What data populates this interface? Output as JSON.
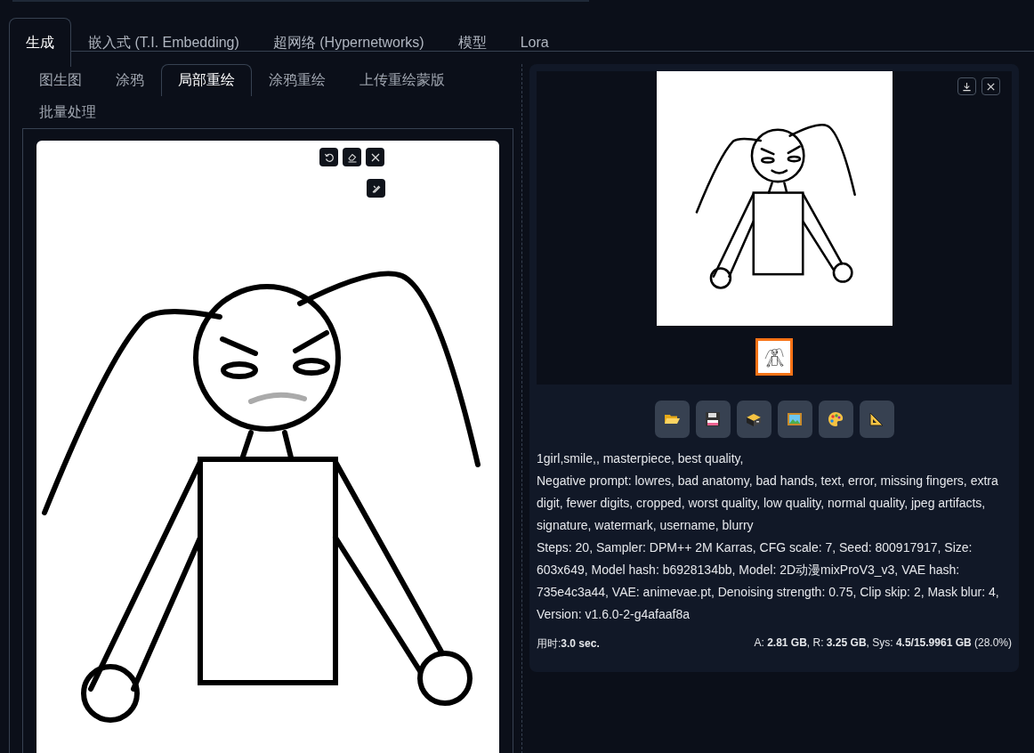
{
  "main_tabs": [
    {
      "label": "生成",
      "selected": true
    },
    {
      "label": "嵌入式 (T.I. Embedding)",
      "selected": false
    },
    {
      "label": "超网络 (Hypernetworks)",
      "selected": false
    },
    {
      "label": "模型",
      "selected": false
    },
    {
      "label": "Lora",
      "selected": false
    }
  ],
  "sub_tabs": [
    {
      "label": "图生图",
      "selected": false
    },
    {
      "label": "涂鸦",
      "selected": false
    },
    {
      "label": "局部重绘",
      "selected": true
    },
    {
      "label": "涂鸦重绘",
      "selected": false
    },
    {
      "label": "上传重绘蒙版",
      "selected": false
    },
    {
      "label": "批量处理",
      "selected": false
    }
  ],
  "output": {
    "thumbnails": [
      {
        "selected": true
      }
    ],
    "info": [
      "1girl,smile,, masterpiece, best quality,",
      "Negative prompt: lowres, bad anatomy, bad hands, text, error, missing fingers, extra digit, fewer digits, cropped, worst quality, low quality, normal quality, jpeg artifacts, signature, watermark, username, blurry",
      "Steps: 20, Sampler: DPM++ 2M Karras, CFG scale: 7, Seed: 800917917, Size: 603x649, Model hash: b6928134bb, Model: 2D动漫mixProV3_v3, VAE hash: 735e4c3a44, VAE: animevae.pt, Denoising strength: 0.75, Clip skip: 2, Mask blur: 4, Version: v1.6.0-2-g4afaaf8a"
    ],
    "time": "用时:**3.0 sec.**",
    "memory": "A: **2.81 GB**, R: **3.25 GB**, Sys: **4.5/15.9961 GB** (28.0%)"
  }
}
